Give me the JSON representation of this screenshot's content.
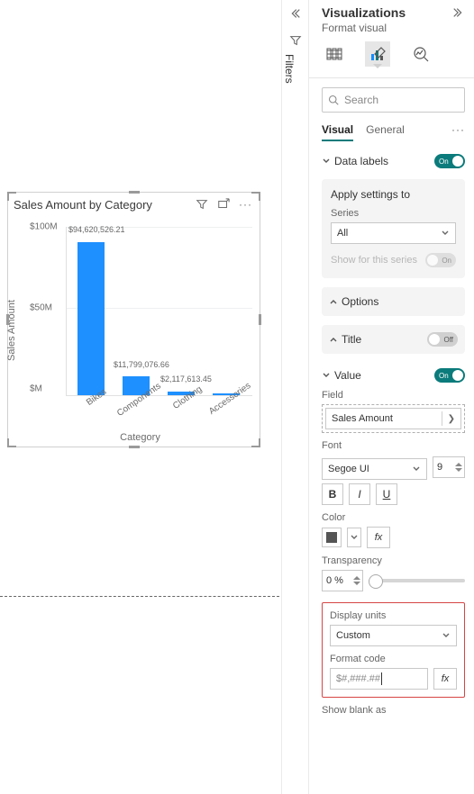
{
  "chart_data": {
    "type": "bar",
    "title": "Sales Amount by Category",
    "xlabel": "Category",
    "ylabel": "Sales Amount",
    "categories": [
      "Bikes",
      "Components",
      "Clothing",
      "Accessories"
    ],
    "values": [
      94620526.21,
      11799076.66,
      2117613.45,
      700000
    ],
    "value_labels": [
      "$94,620,526.21",
      "$11,799,076.66",
      "$2,117,613.45",
      ""
    ],
    "yticks": [
      "$M",
      "$50M",
      "$100M"
    ],
    "ylim": [
      0,
      100000000
    ]
  },
  "filters_rail": {
    "label": "Filters"
  },
  "pane": {
    "title": "Visualizations",
    "subtitle": "Format visual",
    "search_placeholder": "Search",
    "tabs": {
      "visual": "Visual",
      "general": "General"
    },
    "data_labels": {
      "label": "Data labels",
      "on_text": "On"
    },
    "apply": {
      "title": "Apply settings to",
      "series_label": "Series",
      "series_value": "All",
      "show_for_label": "Show for this series",
      "show_for_on": "On"
    },
    "options_label": "Options",
    "title_section": {
      "label": "Title",
      "off_text": "Off"
    },
    "value": {
      "label": "Value",
      "on_text": "On",
      "field_label": "Field",
      "field_value": "Sales Amount",
      "font_label": "Font",
      "font_value": "Segoe UI",
      "font_size": "9",
      "bold": "B",
      "italic": "I",
      "underline": "U",
      "color_label": "Color",
      "fx": "fx",
      "transparency_label": "Transparency",
      "transparency_value": "0 %",
      "display_units_label": "Display units",
      "display_units_value": "Custom",
      "format_code_label": "Format code",
      "format_code_value": "$#,###.##",
      "show_blank_label": "Show blank as"
    }
  }
}
